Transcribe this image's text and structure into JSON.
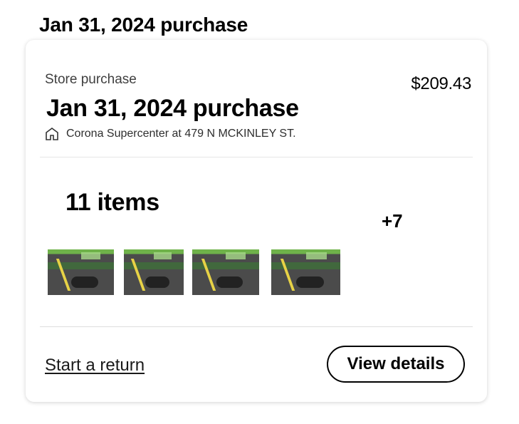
{
  "page": {
    "heading": "Jan 31, 2024 purchase"
  },
  "order": {
    "type_label": "Store purchase",
    "title": "Jan 31, 2024 purchase",
    "total": "$209.43",
    "store": "Corona Supercenter at 479 N MCKINLEY ST.",
    "store_icon": "store-icon"
  },
  "items": {
    "count_label": "11 items",
    "more_label": "+7",
    "thumbnails": [
      "product-thumbnail",
      "product-thumbnail",
      "product-thumbnail",
      "product-thumbnail"
    ]
  },
  "actions": {
    "return_label": "Start a return",
    "details_label": "View details"
  }
}
